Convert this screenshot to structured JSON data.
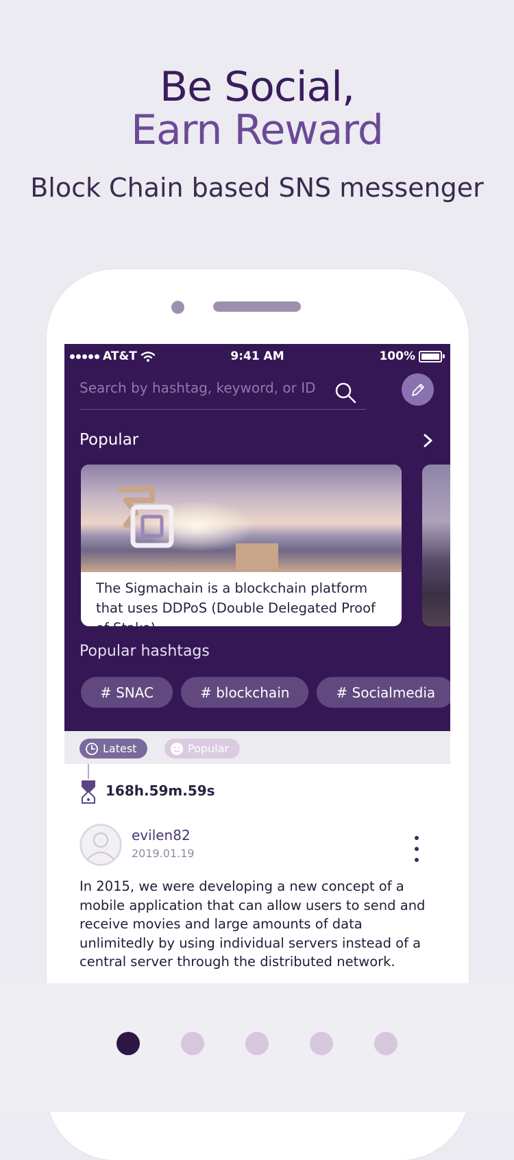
{
  "headline": {
    "line1": "Be Social,",
    "line2": "Earn Reward",
    "subtitle": "Block Chain based SNS messenger"
  },
  "status_bar": {
    "carrier": "AT&T",
    "time": "9:41 AM",
    "battery": "100%"
  },
  "search": {
    "placeholder": "Search by hashtag, keyword, or ID",
    "value": ""
  },
  "popular": {
    "label": "Popular",
    "card_text": "The Sigmachain is a blockchain platform that uses DDPoS (Double Delegated Proof of Stake) .."
  },
  "hashtags": {
    "label": "Popular hashtags",
    "items": [
      "# SNAC",
      "# blockchain",
      "# Socialmedia"
    ]
  },
  "filters": {
    "latest": "Latest",
    "popular": "Popular"
  },
  "post": {
    "timer": "168h.59m.59s",
    "username": "evilen82",
    "date": "2019.01.19",
    "body": "In 2015, we were developing a new concept of a mobile application that can allow users to send and receive movies and large amounts of data unlimitedly by using individual servers instead of a central server through the distributed network."
  },
  "pagination": {
    "total": 5,
    "active": 1
  },
  "colors": {
    "brand_purple": "#361755",
    "accent": "#8a72b0",
    "tag_bg": "#61497f"
  }
}
